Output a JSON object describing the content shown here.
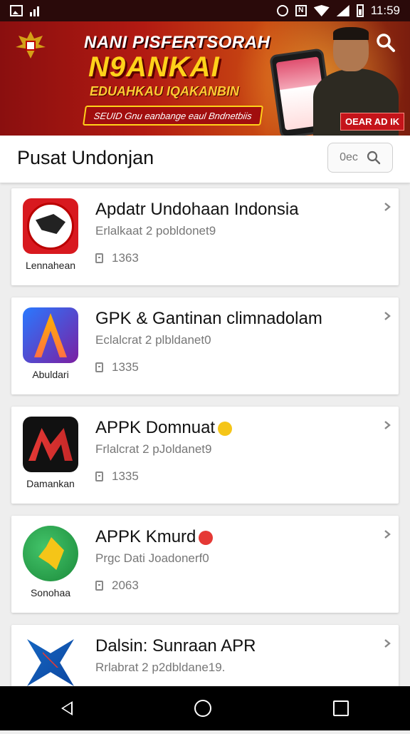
{
  "status_bar": {
    "time": "11:59"
  },
  "banner": {
    "line1": "NANI PISFERTSORAH",
    "line2": "N9ANKAI",
    "line3": "EDUAHKAU IQAKANBIN",
    "tagline": "SEUID Gnu eanbange eaul Bndnetbiis",
    "button_label": "OEAR AD IK"
  },
  "header": {
    "title": "Pusat Undonjan",
    "search_placeholder": "0ec"
  },
  "apps": [
    {
      "name": "Apdatr Undohaan Indonsia",
      "subtitle": "Erlalkaat 2 pobldonet9",
      "size": "1363",
      "caption": "Lennahean",
      "emoji_color": ""
    },
    {
      "name": "GPK & Gantinan climnadolam",
      "subtitle": "Eclalcrat 2 plbldanet0",
      "size": "1335",
      "caption": "Abuldari",
      "emoji_color": ""
    },
    {
      "name": "APPK Domnuat",
      "subtitle": "Frlalcrat 2 pJoldanet9",
      "size": "1335",
      "caption": "Damankan",
      "emoji_color": "#f5c518"
    },
    {
      "name": "APPK Kmurd",
      "subtitle": "Prgc Dati Joadonerf0",
      "size": "2063",
      "caption": "Sonohaa",
      "emoji_color": "#e53935"
    },
    {
      "name": "Dalsin: Sunraan   APR",
      "subtitle": "Rrlabrat 2 p2dbldane19.",
      "size": "",
      "caption": "",
      "emoji_color": "#8bc34a"
    }
  ],
  "colors": {
    "banner_red": "#b21a12",
    "accent_yellow": "#ffd21a"
  }
}
